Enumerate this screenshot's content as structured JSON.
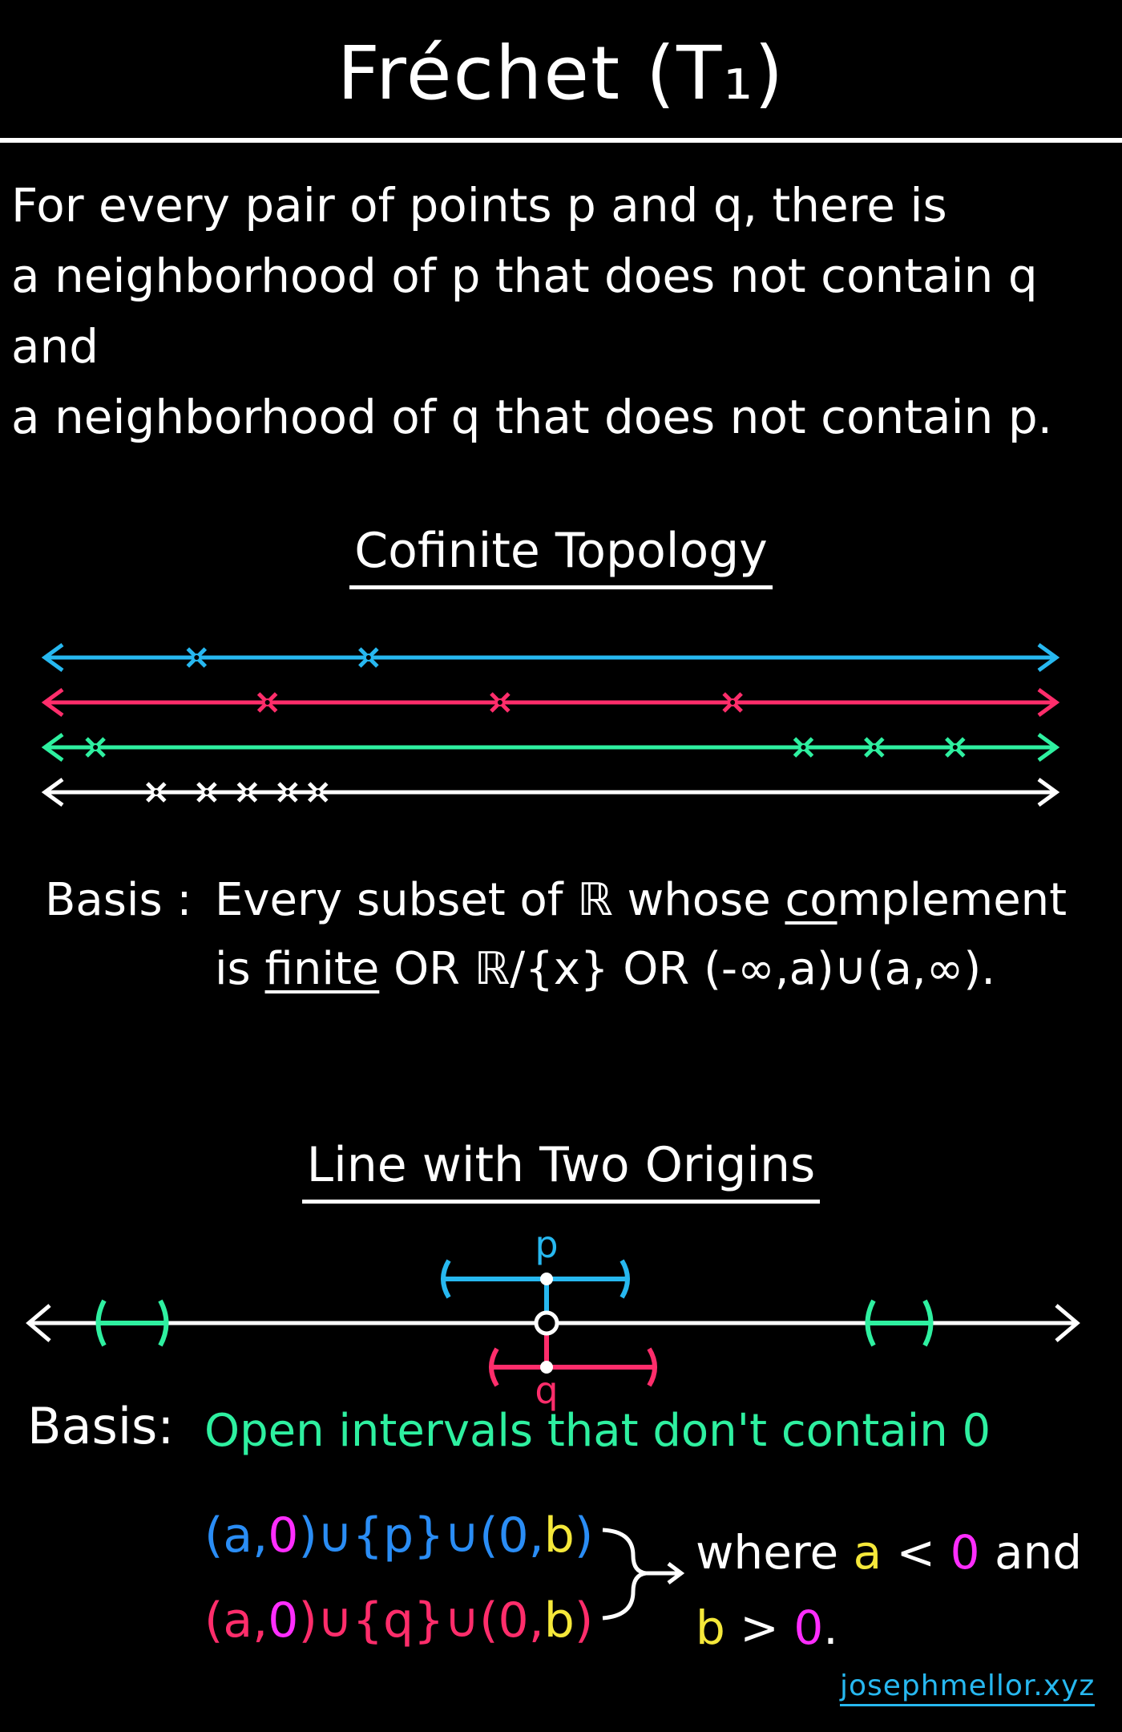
{
  "title": "Fréchet (T₁)",
  "definition": {
    "line1": "For every pair of points p and q, there is",
    "line2": "a neighborhood of p that does not contain q and",
    "line3": "a neighborhood of q that does not contain p."
  },
  "cofinite": {
    "heading": "Cofinite Topology",
    "lines": [
      {
        "color": "#27b8f0",
        "marks": [
          0.15,
          0.32
        ]
      },
      {
        "color": "#ff2d6b",
        "marks": [
          0.22,
          0.45,
          0.68
        ]
      },
      {
        "color": "#2ef0a0",
        "marks": [
          0.05,
          0.75,
          0.82,
          0.9
        ]
      },
      {
        "color": "#ffffff",
        "marks": [
          0.11,
          0.16,
          0.2,
          0.24,
          0.27
        ]
      }
    ],
    "basis_label": "Basis :",
    "basis_pre": "Every subset of ℝ whose ",
    "basis_co": "co",
    "basis_post": "mplement",
    "basis2_pre": "is ",
    "basis2_finite": "finite",
    "basis2_post": " OR ℝ/{x} OR (-∞,a)∪(a,∞)."
  },
  "two_origins": {
    "heading": "Line with Two Origins",
    "p_label": "p",
    "q_label": "q",
    "colors": {
      "p": "#27b8f0",
      "q": "#ff2d6b",
      "side": "#2ef0a0",
      "yellow": "#f5e83a",
      "magenta": "#ff2dff",
      "blue": "#2a8df5"
    },
    "basis_label": "Basis:",
    "basis_text": "Open intervals that don't contain 0",
    "set_p": {
      "a": "(a,",
      "zero": "0",
      "close": ")",
      "union1": "∪",
      "point": "{p}",
      "union2": "∪",
      "interval": "(0,",
      "b": "b",
      "end": ")"
    },
    "set_q": {
      "a": "(a,",
      "zero": "0",
      "close": ")",
      "union1": "∪",
      "point": "{q}",
      "union2": "∪",
      "interval": "(0,",
      "b": "b",
      "end": ")"
    },
    "cond1_pre": "where ",
    "cond1_a": "a",
    "cond1_lt": " < ",
    "cond1_zero": "0",
    "cond1_post": " and",
    "cond2_b": "b",
    "cond2_gt": " > ",
    "cond2_zero": "0",
    "cond2_post": "."
  },
  "credit": "josephmellor.xyz"
}
